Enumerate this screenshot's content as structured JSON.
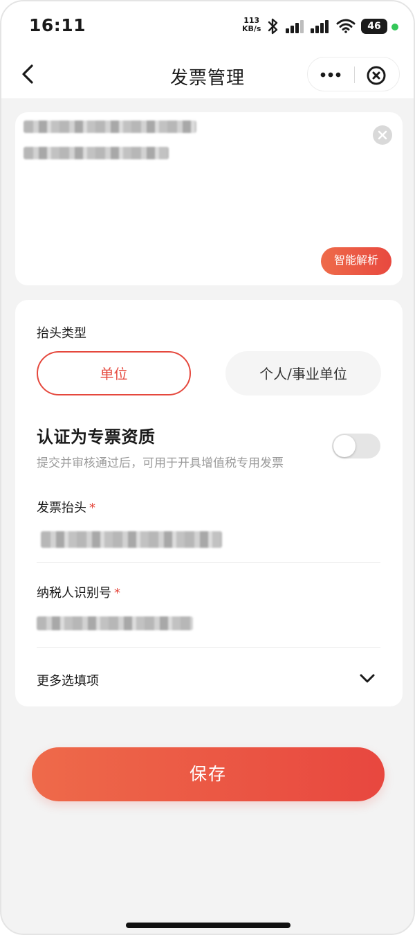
{
  "status_bar": {
    "time": "16:11",
    "net_speed_value": "113",
    "net_speed_unit": "KB/s",
    "battery": "46",
    "icons": [
      "bluetooth-icon",
      "signal-icon",
      "signal-icon",
      "wifi-icon",
      "battery-icon"
    ]
  },
  "nav": {
    "title": "发票管理",
    "icons": [
      "back-icon",
      "more-icon",
      "close-miniprogram-icon"
    ]
  },
  "paste_card": {
    "smart_parse_label": "智能解析",
    "icons": [
      "clear-icon"
    ]
  },
  "form": {
    "header_type_label": "抬头类型",
    "type_options": [
      {
        "label": "单位",
        "selected": true
      },
      {
        "label": "个人/事业单位",
        "selected": false
      }
    ],
    "cert_title": "认证为专票资质",
    "cert_desc": "提交并审核通过后，可用于开具增值税专用发票",
    "cert_enabled": false,
    "invoice_title_label": "发票抬头",
    "taxpayer_id_label": "纳税人识别号",
    "required_mark": "*",
    "more_options_label": "更多选填项"
  },
  "save_label": "保存",
  "colors": {
    "accent": "#e5483d",
    "background": "#f3f3f3",
    "card": "#ffffff"
  }
}
